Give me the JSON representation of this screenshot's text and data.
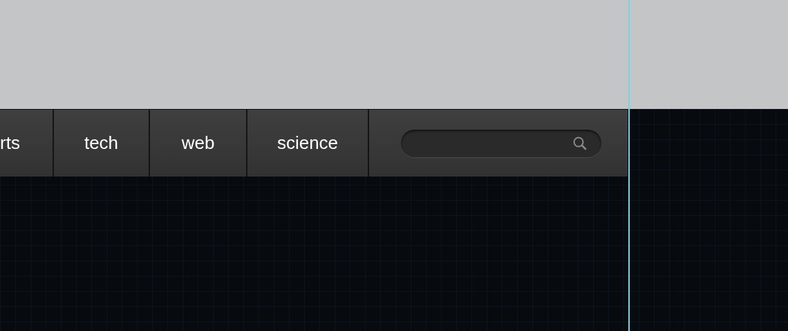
{
  "nav": {
    "tabs": [
      {
        "label": "rts"
      },
      {
        "label": "tech"
      },
      {
        "label": "web"
      },
      {
        "label": "science"
      }
    ]
  }
}
